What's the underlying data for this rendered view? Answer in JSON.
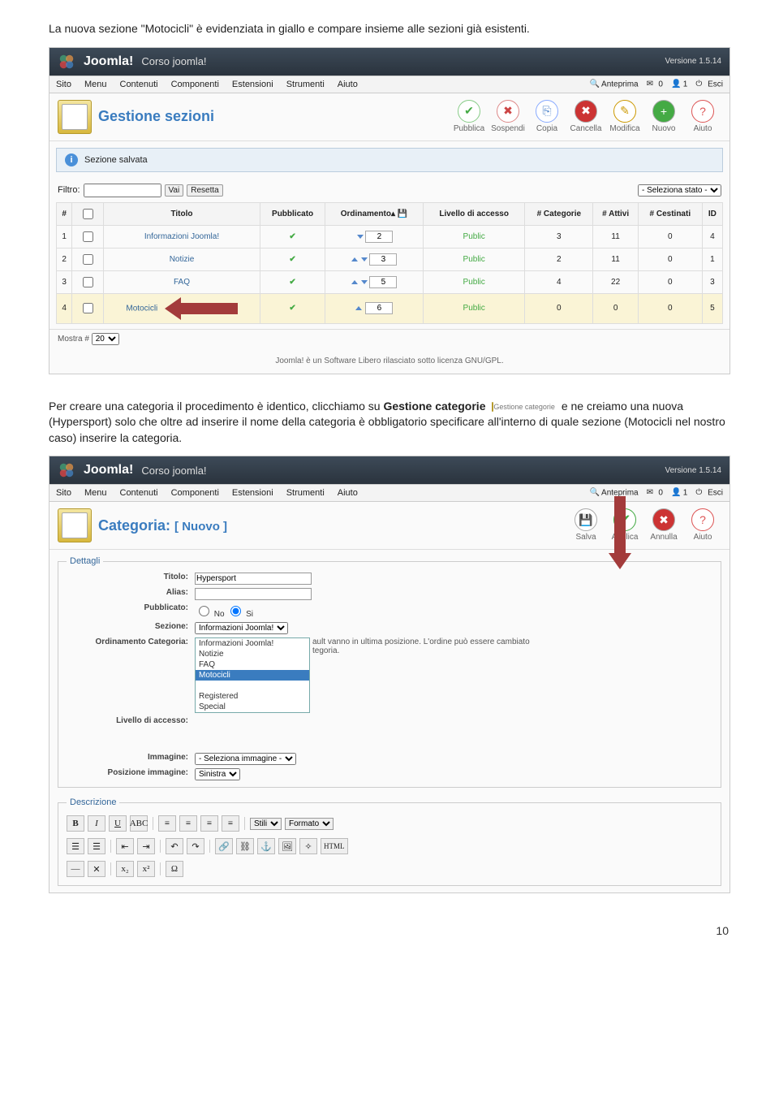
{
  "intro_text": "La nuova sezione \"Motocicli\" è evidenziata in giallo e compare insieme alle sezioni già esistenti.",
  "para2_before": "Per creare una categoria il procedimento è identico, clicchiamo su ",
  "para2_link": "Gestione categorie",
  "para2_iconlabel": "Gestione categorie",
  "para2_after": " e ne creiamo una nuova (Hypersport) solo che oltre ad inserire il nome della categoria è obbligatorio specificare all'interno di quale sezione (Motocicli nel nostro caso) inserire la categoria.",
  "brand": "Joomla!",
  "brand_sub": "Corso joomla!",
  "version": "Versione 1.5.14",
  "menu": [
    "Sito",
    "Menu",
    "Contenuti",
    "Componenti",
    "Estensioni",
    "Strumenti",
    "Aiuto"
  ],
  "menu_right": {
    "anteprima": "Anteprima",
    "zero": "0",
    "one": "1",
    "esci": "Esci"
  },
  "screen1": {
    "title": "Gestione sezioni",
    "toolbar": [
      "Pubblica",
      "Sospendi",
      "Copia",
      "Cancella",
      "Modifica",
      "Nuovo",
      "Aiuto"
    ],
    "msg": "Sezione salvata",
    "filter_label": "Filtro:",
    "btn_go": "Vai",
    "btn_reset": "Resetta",
    "state_filter": "- Seleziona stato -",
    "headers": [
      "#",
      "",
      "Titolo",
      "Pubblicato",
      "Ordinamento▴",
      "Livello di accesso",
      "# Categorie",
      "# Attivi",
      "# Cestinati",
      "ID"
    ],
    "save_ord_title": "💾",
    "rows": [
      {
        "n": "1",
        "title": "Informazioni Joomla!",
        "ord": "2",
        "ordctl": "dn",
        "access": "Public",
        "cats": "3",
        "active": "11",
        "trash": "0",
        "id": "4",
        "hl": false
      },
      {
        "n": "2",
        "title": "Notizie",
        "ord": "3",
        "ordctl": "both",
        "access": "Public",
        "cats": "2",
        "active": "11",
        "trash": "0",
        "id": "1",
        "hl": false
      },
      {
        "n": "3",
        "title": "FAQ",
        "ord": "5",
        "ordctl": "both",
        "access": "Public",
        "cats": "4",
        "active": "22",
        "trash": "0",
        "id": "3",
        "hl": false
      },
      {
        "n": "4",
        "title": "Motocicli",
        "ord": "6",
        "ordctl": "up",
        "access": "Public",
        "cats": "0",
        "active": "0",
        "trash": "0",
        "id": "5",
        "hl": true
      }
    ],
    "mostra_label": "Mostra #",
    "mostra_val": "20",
    "footer": "Joomla! è un Software Libero rilasciato sotto licenza GNU/GPL."
  },
  "screen2": {
    "title": "Categoria:",
    "title_suffix": "[ Nuovo ]",
    "toolbar": [
      "Salva",
      "Applica",
      "Annulla",
      "Aiuto"
    ],
    "legend": "Dettagli",
    "f_titolo": "Titolo:",
    "v_titolo": "Hypersport",
    "f_alias": "Alias:",
    "v_alias": "",
    "f_pub": "Pubblicato:",
    "pub_no": "No",
    "pub_si": "Si",
    "f_sezione": "Sezione:",
    "sez_selected": "Informazioni Joomla!",
    "f_ordcat": "Ordinamento Categoria:",
    "ordcat_note": "ault vanno in ultima posizione. L'ordine può essere cambiato",
    "ordcat_note2": "tegoria.",
    "f_access": "Livello di accesso:",
    "sez_options": [
      "Informazioni Joomla!",
      "Notizie",
      "FAQ",
      "Motocicli",
      "",
      "Registered",
      "Special"
    ],
    "sez_highlight": "Motocicli",
    "f_img": "Immagine:",
    "v_img": "- Seleziona immagine -",
    "f_imgpos": "Posizione immagine:",
    "v_imgpos": "Sinistra",
    "legend2": "Descrizione",
    "ed_stili": "Stili",
    "ed_formato": "Formato"
  },
  "page_num": "10"
}
